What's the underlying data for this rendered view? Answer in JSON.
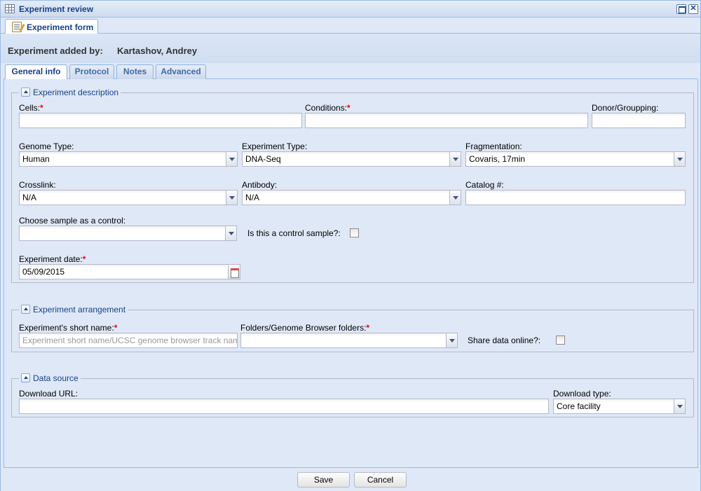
{
  "window": {
    "title": "Experiment review"
  },
  "outer_tab": {
    "label": "Experiment form"
  },
  "added_by": {
    "label": "Experiment added by:",
    "value": "Kartashov, Andrey"
  },
  "inner_tabs": [
    "General info",
    "Protocol",
    "Notes",
    "Advanced"
  ],
  "sections": {
    "description": {
      "legend": "Experiment description",
      "cells_label": "Cells:",
      "cells_value": "",
      "conditions_label": "Conditions:",
      "conditions_value": "",
      "donor_label": "Donor/Groupping:",
      "donor_value": "",
      "genome_label": "Genome Type:",
      "genome_value": "Human",
      "exptype_label": "Experiment Type:",
      "exptype_value": "DNA-Seq",
      "frag_label": "Fragmentation:",
      "frag_value": "Covaris, 17min",
      "crosslink_label": "Crosslink:",
      "crosslink_value": "N/A",
      "antibody_label": "Antibody:",
      "antibody_value": "N/A",
      "catalog_label": "Catalog #:",
      "catalog_value": "",
      "control_label": "Choose sample as a control:",
      "control_value": "",
      "is_control_label": "Is this a control sample?:",
      "date_label": "Experiment date:",
      "date_value": "05/09/2015"
    },
    "arrangement": {
      "legend": "Experiment arrangement",
      "shortname_label": "Experiment's short name:",
      "shortname_placeholder": "Experiment short name/UCSC genome browser track name",
      "folders_label": "Folders/Genome Browser folders:",
      "folders_value": "",
      "share_label": "Share data online?:"
    },
    "source": {
      "legend": "Data source",
      "url_label": "Download URL:",
      "url_value": "",
      "dltype_label": "Download type:",
      "dltype_value": "Core facility"
    }
  },
  "buttons": {
    "save": "Save",
    "cancel": "Cancel"
  },
  "required_marker": "*"
}
